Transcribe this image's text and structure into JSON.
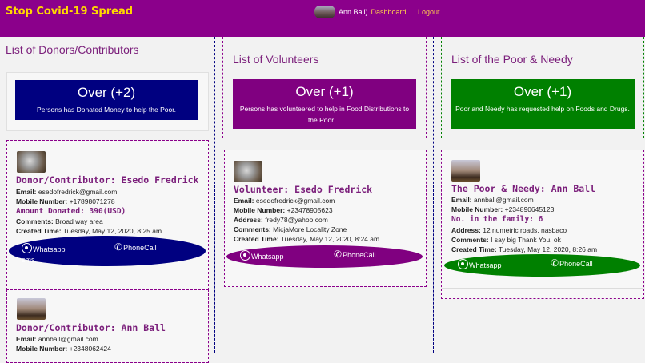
{
  "header": {
    "brand": "Stop Covid-19 Spread",
    "user_name": "Ann Ball)",
    "dashboard": "Dashboard",
    "logout": "Logout"
  },
  "donors": {
    "title": "List of Donors/Contributors",
    "count": "Over (+2)",
    "desc": "Persons has Donated Money to help the Poor.",
    "cards": [
      {
        "title": "Donor/Contributor: Esedo Fredrick",
        "email_label": "Email:",
        "email": "esedofredrick@gmail.com",
        "mobile_label": "Mobile Number:",
        "mobile": "+17898071278",
        "amount": "Amount Donated: 390(USD)",
        "comments_label": "Comments:",
        "comments": "Broad way area",
        "created_label": "Created Time:",
        "created": "Tuesday, May 12, 2020, 8:25 am",
        "whatsapp": "Whatsapp",
        "sms": "sms",
        "phonecall": "PhoneCall"
      },
      {
        "title": "Donor/Contributor: Ann Ball",
        "email_label": "Email:",
        "email": "annball@gmail.com",
        "mobile_label": "Mobile Number:",
        "mobile": "+2348062424"
      }
    ]
  },
  "volunteers": {
    "title": "List of Volunteers",
    "count": "Over (+1)",
    "desc": "Persons has volunteered to help in Food Distributions to the Poor....",
    "card": {
      "title": "Volunteer: Esedo Fredrick",
      "email_label": "Email:",
      "email": "esedofredrick@gmail.com",
      "mobile_label": "Mobile Number:",
      "mobile": "+23478905623",
      "address_label": "Address:",
      "address": "fredy78@yahoo.com",
      "comments_label": "Comments:",
      "comments": "MicjaMore Locality Zone",
      "created_label": "Created Time:",
      "created": "Tuesday, May 12, 2020, 8:24 am",
      "whatsapp": "Whatsapp",
      "phonecall": "PhoneCall"
    }
  },
  "needy": {
    "title": "List of the Poor & Needy",
    "count": "Over (+1)",
    "desc": "Poor and Needy has requested help on Foods and Drugs.",
    "card": {
      "title": "The Poor & Needy: Ann Ball",
      "email_label": "Email:",
      "email": "annball@gmail.com",
      "mobile_label": "Mobile Number:",
      "mobile": "+234890645123",
      "family": "No. in the family: 6",
      "address_label": "Address:",
      "address": "12 numetric roads, nasbaco",
      "comments_label": "Comments:",
      "comments": "I say big Thank You. ok",
      "created_label": "Created Time:",
      "created": "Tuesday, May 12, 2020, 8:26 am",
      "whatsapp": "Whatsapp",
      "phonecall": "PhoneCall"
    }
  },
  "colors": {
    "header": "#8b008b",
    "brand": "#ffd700",
    "donor": "#000080",
    "volunteer": "#800080",
    "needy": "#008000"
  }
}
